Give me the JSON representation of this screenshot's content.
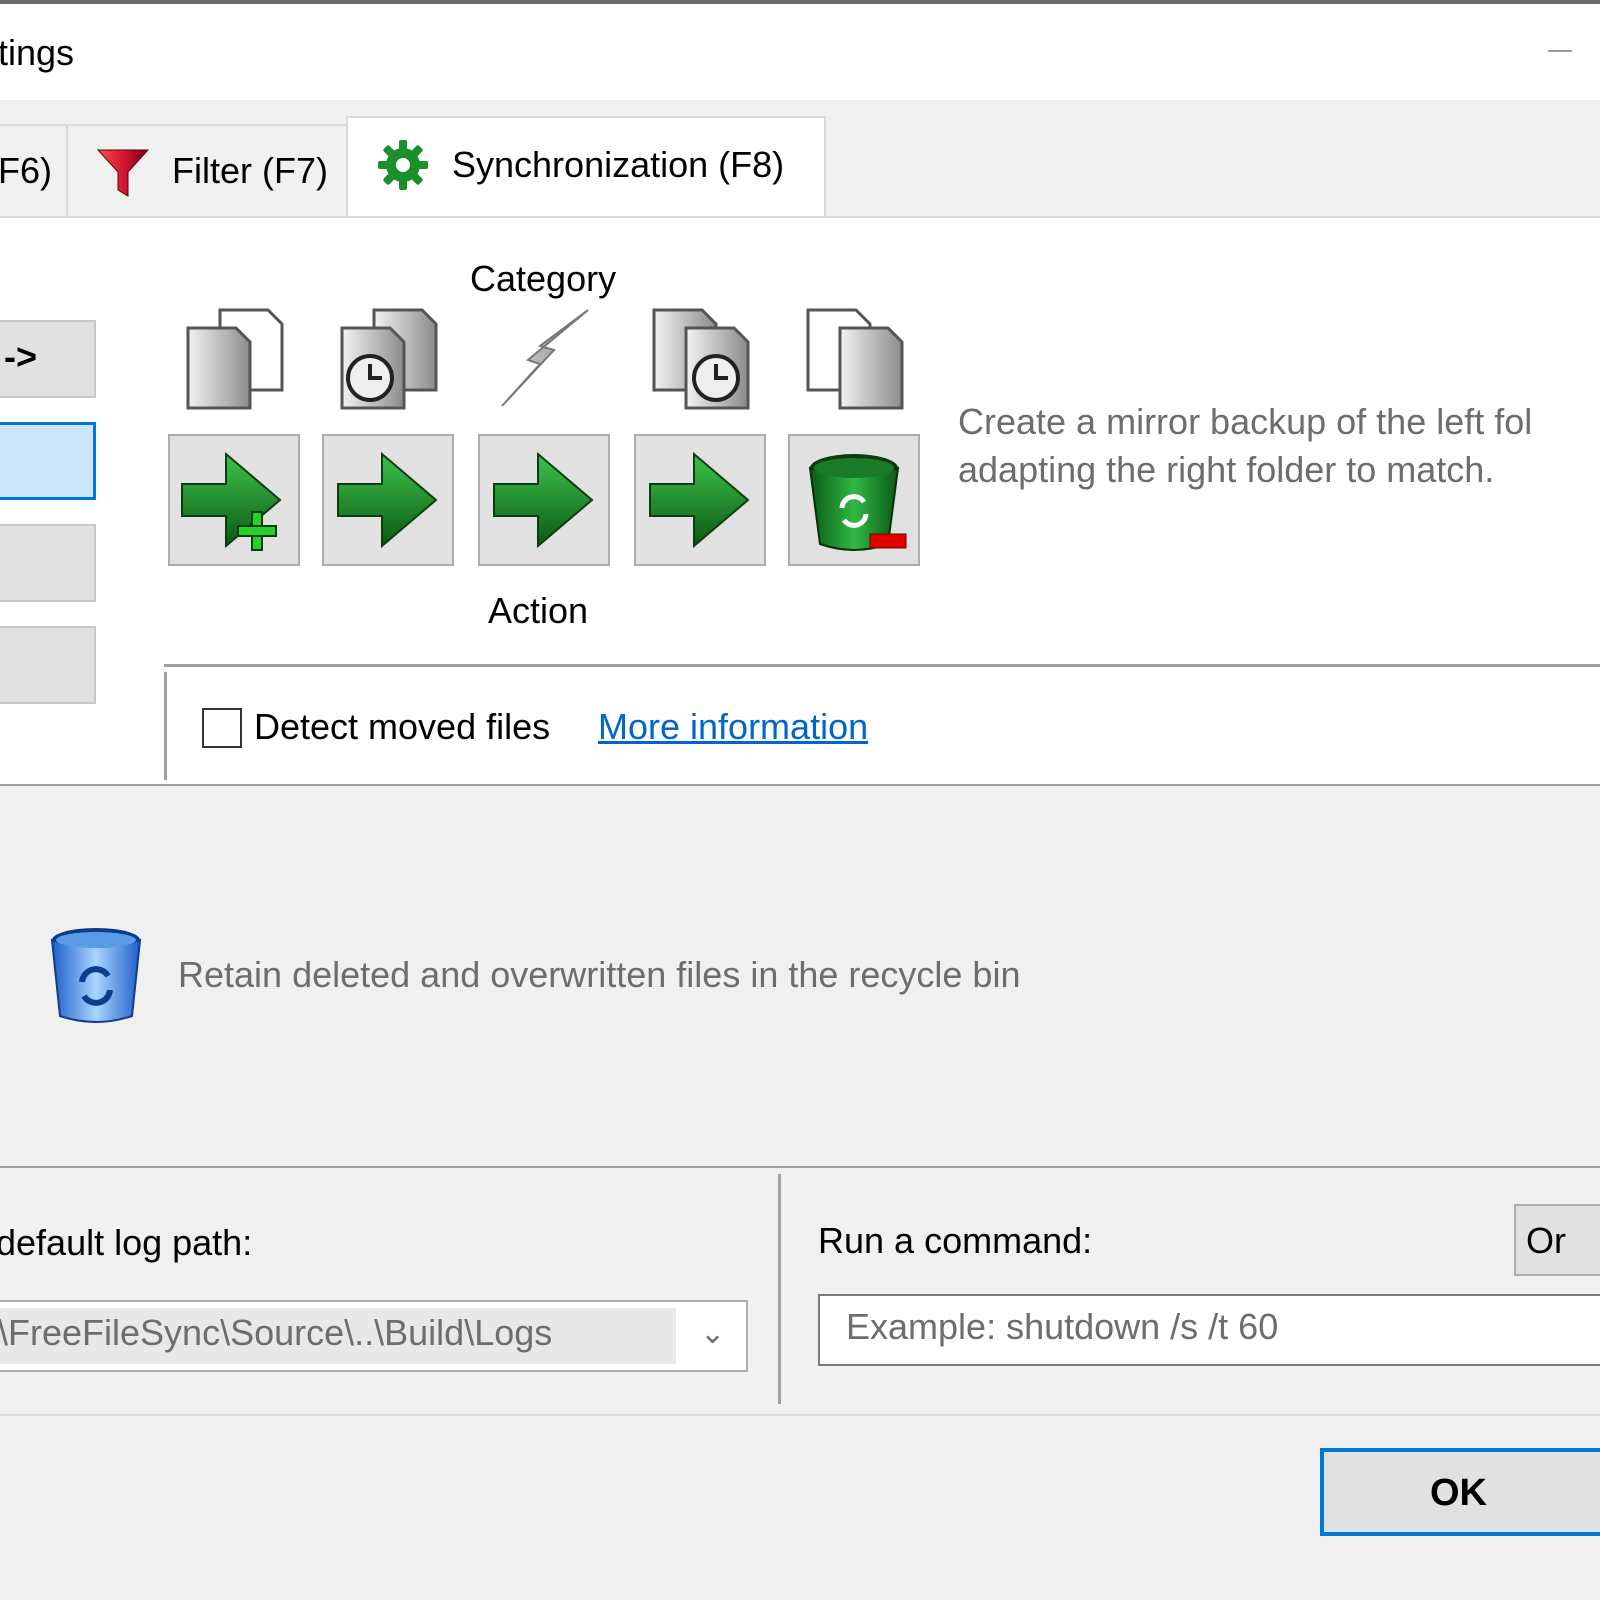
{
  "window": {
    "title": "tings"
  },
  "tabs": [
    {
      "label": "F6)",
      "icon": "compare-icon"
    },
    {
      "label": "Filter (F7)",
      "icon": "filter-funnel-icon"
    },
    {
      "label": "Synchronization (F8)",
      "icon": "gear-icon",
      "active": true
    }
  ],
  "variants": [
    {
      "label": "->",
      "selected": false
    },
    {
      "label": "",
      "selected": true
    },
    {
      "label": "",
      "selected": false
    },
    {
      "label": "",
      "selected": false
    }
  ],
  "sync_grid": {
    "category_label": "Category",
    "action_label": "Action",
    "categories": [
      "left-only-icon",
      "left-newer-icon",
      "conflict-icon",
      "right-newer-icon",
      "right-only-icon"
    ],
    "actions": [
      "create-right-icon",
      "update-right-icon",
      "update-right-icon",
      "update-right-icon",
      "delete-right-icon"
    ]
  },
  "description": {
    "line1": "Create a mirror backup of the left fol",
    "line2": "adapting the right folder to match."
  },
  "detect_moved": {
    "label": "Detect moved files",
    "checked": false,
    "link": "More information"
  },
  "deletion": {
    "text": "Retain deleted and overwritten files in the recycle bin",
    "icon": "recycle-bin-icon"
  },
  "log": {
    "label": "default log path:",
    "value": "\\FreeFileSync\\Source\\..\\Build\\Logs"
  },
  "command": {
    "label": "Run a command:",
    "placeholder": "Example: shutdown /s /t 60",
    "on_button": "Or"
  },
  "footer": {
    "ok_label": "OK"
  },
  "colors": {
    "accent": "#0078d7",
    "link": "#0066cc",
    "green": "#1a8f2a",
    "funnel": "#c8102e"
  }
}
